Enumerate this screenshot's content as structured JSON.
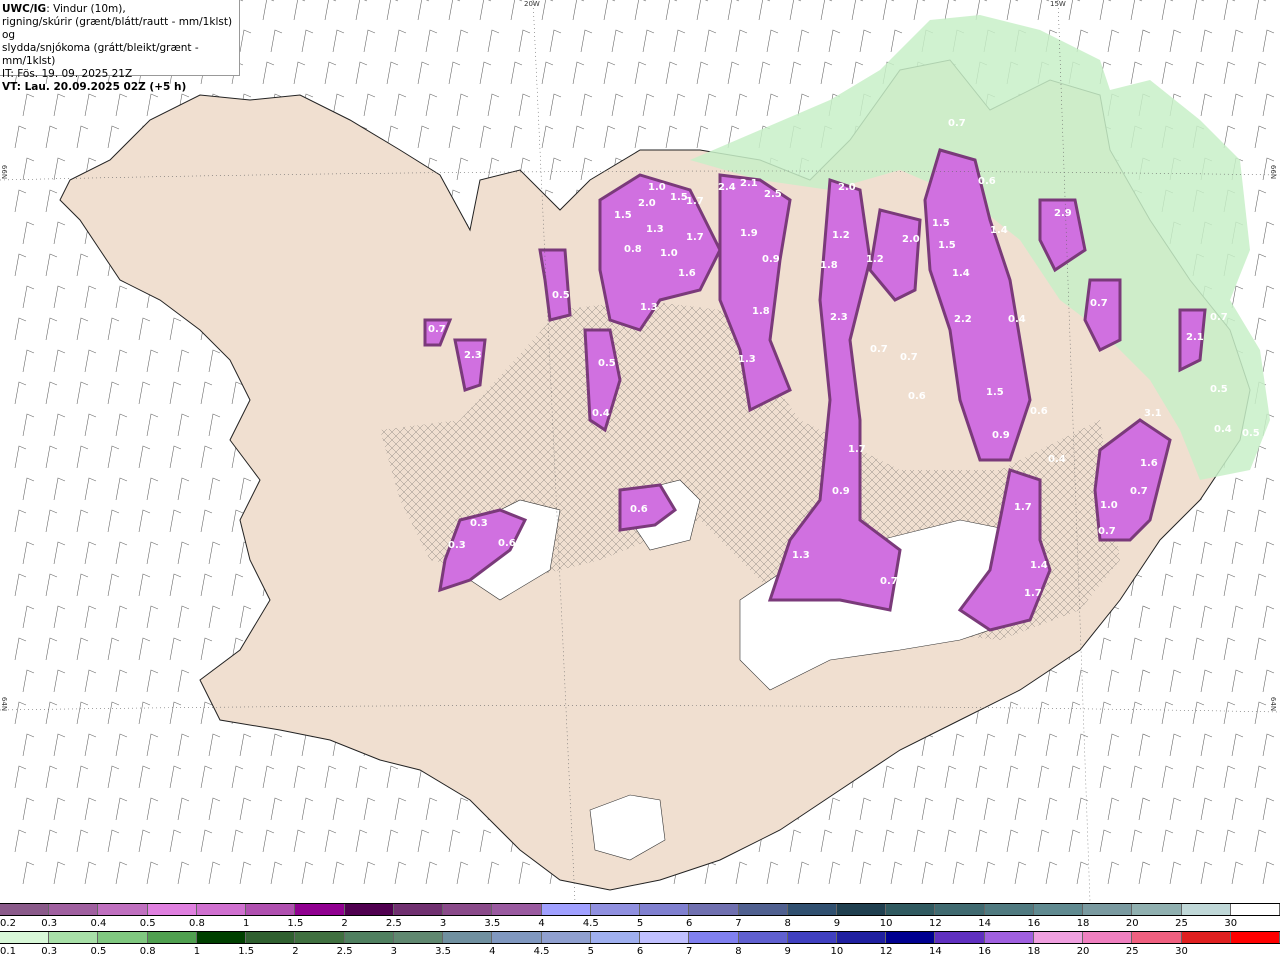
{
  "title": {
    "brand": "UWC/IG",
    "line1": ": Vindur (10m),",
    "line2": "rigning/skúrir (grænt/blátt/rautt - mm/1klst) og",
    "line3": "slydda/snjókoma (grátt/bleikt/grænt - mm/1klst)",
    "line4": "IT: Fös. 19. 09. 2025 21Z",
    "line5": "VT: Lau. 20.09.2025 02Z (+5 h)"
  },
  "graticule": {
    "lon_top": [
      "20W",
      "15W"
    ],
    "lat_left": [
      "66N",
      "64N"
    ],
    "lat_right": [
      "66N",
      "64N"
    ]
  },
  "colors": {
    "sea": "#ffffff",
    "land": "#f0dfd0",
    "coast": "#222222",
    "roads": "#e06030",
    "glacier": "#ffffff",
    "rain_light": "#c8f0c8",
    "snow_main": "#d070e0",
    "snow_dark": "#7a3a7a"
  },
  "map": {
    "value_labels": [
      {
        "t": "1.0"
      },
      {
        "t": "1.5"
      },
      {
        "t": "2.0"
      },
      {
        "t": "1.3"
      },
      {
        "t": "0.8"
      },
      {
        "t": "1.0"
      },
      {
        "t": "1.6"
      },
      {
        "t": "1.7"
      },
      {
        "t": "1.5"
      },
      {
        "t": "1.3"
      },
      {
        "t": "2.4"
      },
      {
        "t": "2.1"
      },
      {
        "t": "2.5"
      },
      {
        "t": "1.9"
      },
      {
        "t": "0.9"
      },
      {
        "t": "1.8"
      },
      {
        "t": "1.3"
      },
      {
        "t": "2.0"
      },
      {
        "t": "1.2"
      },
      {
        "t": "1.8"
      },
      {
        "t": "1.2"
      },
      {
        "t": "2.3"
      },
      {
        "t": "0.7"
      },
      {
        "t": "0.7"
      },
      {
        "t": "2.0"
      },
      {
        "t": "1.5"
      },
      {
        "t": "1.5"
      },
      {
        "t": "1.4"
      },
      {
        "t": "2.2"
      },
      {
        "t": "0.6"
      },
      {
        "t": "1.4"
      },
      {
        "t": "0.4"
      },
      {
        "t": "1.5"
      },
      {
        "t": "0.9"
      },
      {
        "t": "2.9"
      },
      {
        "t": "0.7"
      },
      {
        "t": "0.7"
      },
      {
        "t": "2.1"
      },
      {
        "t": "3.1"
      },
      {
        "t": "1.6"
      },
      {
        "t": "0.4"
      },
      {
        "t": "0.5"
      },
      {
        "t": "1.7"
      },
      {
        "t": "1.7"
      },
      {
        "t": "0.9"
      },
      {
        "t": "1.3"
      },
      {
        "t": "0.7"
      },
      {
        "t": "1.7"
      },
      {
        "t": "1.4"
      },
      {
        "t": "1.0"
      },
      {
        "t": "0.7"
      },
      {
        "t": "0.7"
      },
      {
        "t": "0.6"
      },
      {
        "t": "0.4"
      },
      {
        "t": "0.6"
      },
      {
        "t": "0.3"
      },
      {
        "t": "0.3"
      },
      {
        "t": "0.6"
      },
      {
        "t": "0.5"
      },
      {
        "t": "0.7"
      },
      {
        "t": "2.3"
      },
      {
        "t": "0.5"
      },
      {
        "t": "0.4"
      },
      {
        "t": "0.6"
      },
      {
        "t": "1.7"
      },
      {
        "t": "0.7"
      },
      {
        "t": "0.5"
      }
    ]
  },
  "legend_top": {
    "labels": [
      "0.2",
      "0.3",
      "0.4",
      "0.5",
      "0.8",
      "1",
      "1.5",
      "2",
      "2.5",
      "3",
      "3.5",
      "4",
      "4.5",
      "5",
      "6",
      "7",
      "8",
      "9",
      "10",
      "12",
      "14",
      "16",
      "18",
      "20",
      "25",
      "30"
    ],
    "colors": [
      "#8a5a8a",
      "#a060a0",
      "#c070c0",
      "#e080e0",
      "#d070d0",
      "#b050b0",
      "#900090",
      "#500050",
      "#703070",
      "#8a4a8a",
      "#9a5aa0",
      "#a0a0ff",
      "#9090e0",
      "#8080d0",
      "#7070b0",
      "#506090",
      "#305070",
      "#204050",
      "#305a60",
      "#406a70",
      "#507a80",
      "#608a90",
      "#7a9aa0",
      "#90b0b0",
      "#c0d8d8",
      "#ffffff"
    ]
  },
  "legend_bottom": {
    "labels": [
      "0.1",
      "0.3",
      "0.5",
      "0.8",
      "1",
      "1.5",
      "2",
      "2.5",
      "3",
      "3.5",
      "4",
      "4.5",
      "5",
      "6",
      "7",
      "8",
      "9",
      "10",
      "12",
      "14",
      "16",
      "18",
      "20",
      "25",
      "30"
    ],
    "colors": [
      "#d8f8d8",
      "#a8e0a8",
      "#80c880",
      "#50a050",
      "#004000",
      "#306030",
      "#407040",
      "#508060",
      "#608870",
      "#7090a0",
      "#8098c0",
      "#90a0d0",
      "#a0b0f0",
      "#c0c0ff",
      "#8080f0",
      "#6060d0",
      "#4040c0",
      "#2020a0",
      "#000090",
      "#6030c0",
      "#a060e0",
      "#f0a0e0",
      "#f080c0",
      "#f06080",
      "#e02020",
      "#ff0000"
    ]
  }
}
